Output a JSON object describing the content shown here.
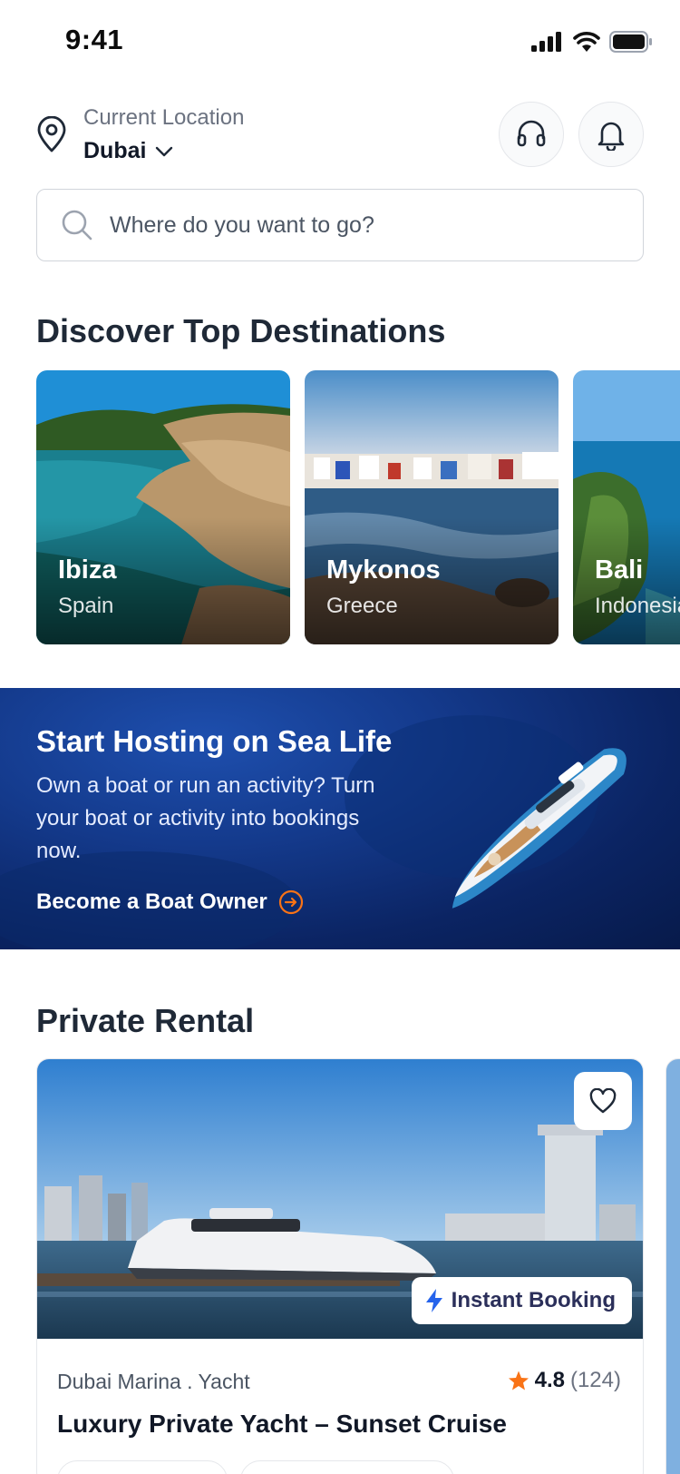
{
  "status_bar": {
    "time": "9:41"
  },
  "location": {
    "label": "Current Location",
    "value": "Dubai"
  },
  "search": {
    "placeholder": "Where do you want to go?"
  },
  "destinations_section": {
    "title": "Discover Top Destinations",
    "items": [
      {
        "name": "Ibiza",
        "country": "Spain"
      },
      {
        "name": "Mykonos",
        "country": "Greece"
      },
      {
        "name": "Bali",
        "country": "Indonesia"
      }
    ]
  },
  "promo": {
    "title": "Start Hosting on Sea Life",
    "text": "Own a boat or run an activity? Turn your boat or activity into bookings now.",
    "cta": "Become a Boat Owner"
  },
  "rental_section": {
    "title": "Private Rental",
    "card": {
      "badge": "Instant Booking",
      "meta": "Dubai Marina . Yacht",
      "rating": "4.8",
      "reviews": "(124)",
      "title": "Luxury Private Yacht – Sunset Cruise"
    }
  },
  "colors": {
    "accent_orange": "#f97316",
    "brand_blue": "#1d4ed8",
    "text_dark": "#111827"
  },
  "icons": [
    "pin-icon",
    "chevron-down-icon",
    "headset-icon",
    "bell-icon",
    "search-icon",
    "arrow-circle-icon",
    "heart-icon",
    "bolt-icon",
    "star-icon"
  ]
}
